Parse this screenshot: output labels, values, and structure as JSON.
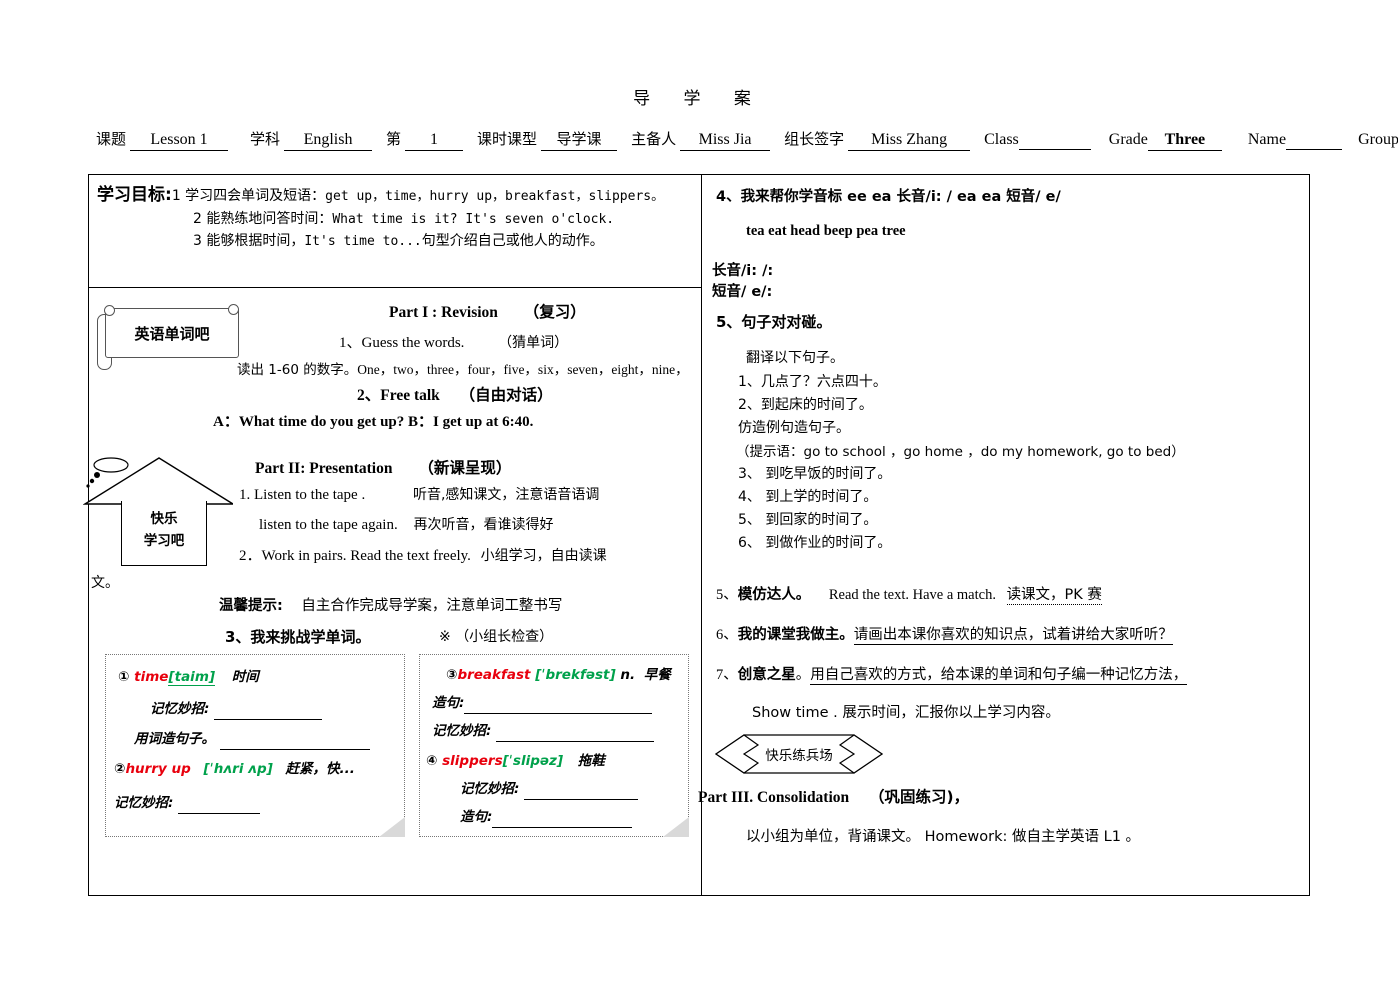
{
  "document": {
    "title": "导    学    案"
  },
  "meta": {
    "topic_label": "课题",
    "topic_value": "Lesson 1",
    "subject_label": "学科",
    "subject_value": "English",
    "no_label": "第",
    "no_value": "1",
    "period_label": "课时课型",
    "period_value": "导学课",
    "author_label": "主备人",
    "author_value": "Miss Jia",
    "leader_label": "组长签字",
    "leader_value": "Miss   Zhang",
    "class_label": "Class",
    "class_value": "",
    "grade_label": "Grade",
    "grade_value": "Three",
    "name_label": "Name",
    "name_value": "",
    "group_label": "Group",
    "group_value": ""
  },
  "objectives": {
    "heading": "学习目标:",
    "line1_cn": "1 学习四会单词及短语：",
    "line1_en": "get up，time，hurry up，breakfast，slippers。",
    "line2_cn": "2 能熟练地问答时间：",
    "line2_en": "What time is it? It's seven o'clock.",
    "line3_cn": "3 能够根据时间，",
    "line3_en": "It's  time to...",
    "line3_cn2": "句型介绍自己或他人的动作。"
  },
  "left": {
    "scroll_label": "英语单词吧",
    "part1_title": "Part I :   Revision",
    "part1_title_cn": "（复习）",
    "guess": "1、Guess   the   words.",
    "guess_cn": "（猜单词）",
    "numbers_cn": "读出 1-60 的数字。",
    "numbers_en": "One，two，three，four，five，six，seven，eight，nine，",
    "freetalk": "2、Free   talk",
    "freetalk_cn": "（自由对话）",
    "dialogue": "A：What time do you get up?   B：I get up at 6:40.",
    "house_line1": "快乐",
    "house_line2": "学习吧",
    "part2_title": "Part  II:  Presentation",
    "part2_title_cn": "（新课呈现）",
    "step1_en": "1.  Listen   to   the   tape .",
    "step1_cn": "听音,感知课文，注意语音语调",
    "step1b_en": "listen  to   the   tape   again.",
    "step1b_cn": "再次听音，看谁读得好",
    "step2_en": "2．Work in  pairs.  Read  the text  freely.",
    "step2_cn": "小组学习，自由读课",
    "step2_cn_wrap": "文。",
    "tip_label": "温馨提示:",
    "tip_text": "自主合作完成导学案，注意单词工整书写",
    "challenge": "3、我来挑战学单词。",
    "check_mark": "※",
    "check_text": "（小组长检查）"
  },
  "vocab": {
    "box1": {
      "w1_num": "①",
      "w1_word": "time",
      "w1_phon": "[taim]",
      "w1_cn": "时间",
      "w1_tip_label": "记忆妙招:",
      "w1_sent_label": "用词造句子。",
      "w2_num": "②",
      "w2_word": "hurry    up",
      "w2_phon": "[ˈhʌri ʌp]",
      "w2_cn": "赶紧，快...",
      "w2_tip_label": "记忆妙招:"
    },
    "box2": {
      "w3_num": "③",
      "w3_word": "breakfast",
      "w3_phon": "[ˈbrekfəst]",
      "w3_pos": "n.",
      "w3_cn": "早餐",
      "w3_sent_label": "造句:",
      "w3_tip_label": "记忆妙招:",
      "w4_num": "④",
      "w4_word": "slippers",
      "w4_phon": "[ˈslipəz]",
      "w4_cn": "拖鞋",
      "w4_tip_label": "记忆妙招:",
      "w4_sent_label": "造句:"
    }
  },
  "right": {
    "phonetics_heading": "4、我来帮你学音标  ee     ea  长音/i: /   ea   ea  短音/ e/",
    "phonetics_words": "tea        eat      head     beep     pea   tree",
    "long_vowel": "长音/i: /:",
    "short_vowel": "短音/ e/:",
    "section5_heading": "5、句子对对碰。",
    "translate_label": "翻译以下句子。",
    "t1": "1、几点了？六点四十。",
    "t2": "2、到起床的时间了。",
    "pattern_label": "仿造例句造句子。",
    "hint": "（提示语：go to school ，go home ，do my homework,  go to bed）",
    "t3": "3、  到吃早饭的时间了。",
    "t4": "4、  到上学的时间了。",
    "t5": "5、  到回家的时间了。",
    "t6": "6、  到做作业的时间了。",
    "imitate_num": "5、",
    "imitate_title": "模仿达人。",
    "imitate_en": "Read   the   text.   Have   a   match.",
    "imitate_cn": "读课文，PK 赛",
    "myclass_num": "6、",
    "myclass_title": "我的课堂我做主。",
    "myclass_text": "请画出本课你喜欢的知识点，试着讲给大家听听？",
    "star_num": "7、",
    "star_title": "创意之星",
    "star_dot": "。",
    "star_text": "用自己喜欢的方式，给本课的单词和句子编一种记忆方法，",
    "showtime": "Show   time .    展示时间，汇报你以上学习内容。",
    "banner_label": "快乐练兵场",
    "part3_title": "Part III. Consolidation",
    "part3_title_cn": "（巩固练习)，",
    "homework": "以小组为单位，背诵课文。   Homework: 做自主学英语 L1 。"
  },
  "colors": {
    "word_red": "#e8000d",
    "phonetic_green": "#00a14b",
    "border": "#000000"
  }
}
